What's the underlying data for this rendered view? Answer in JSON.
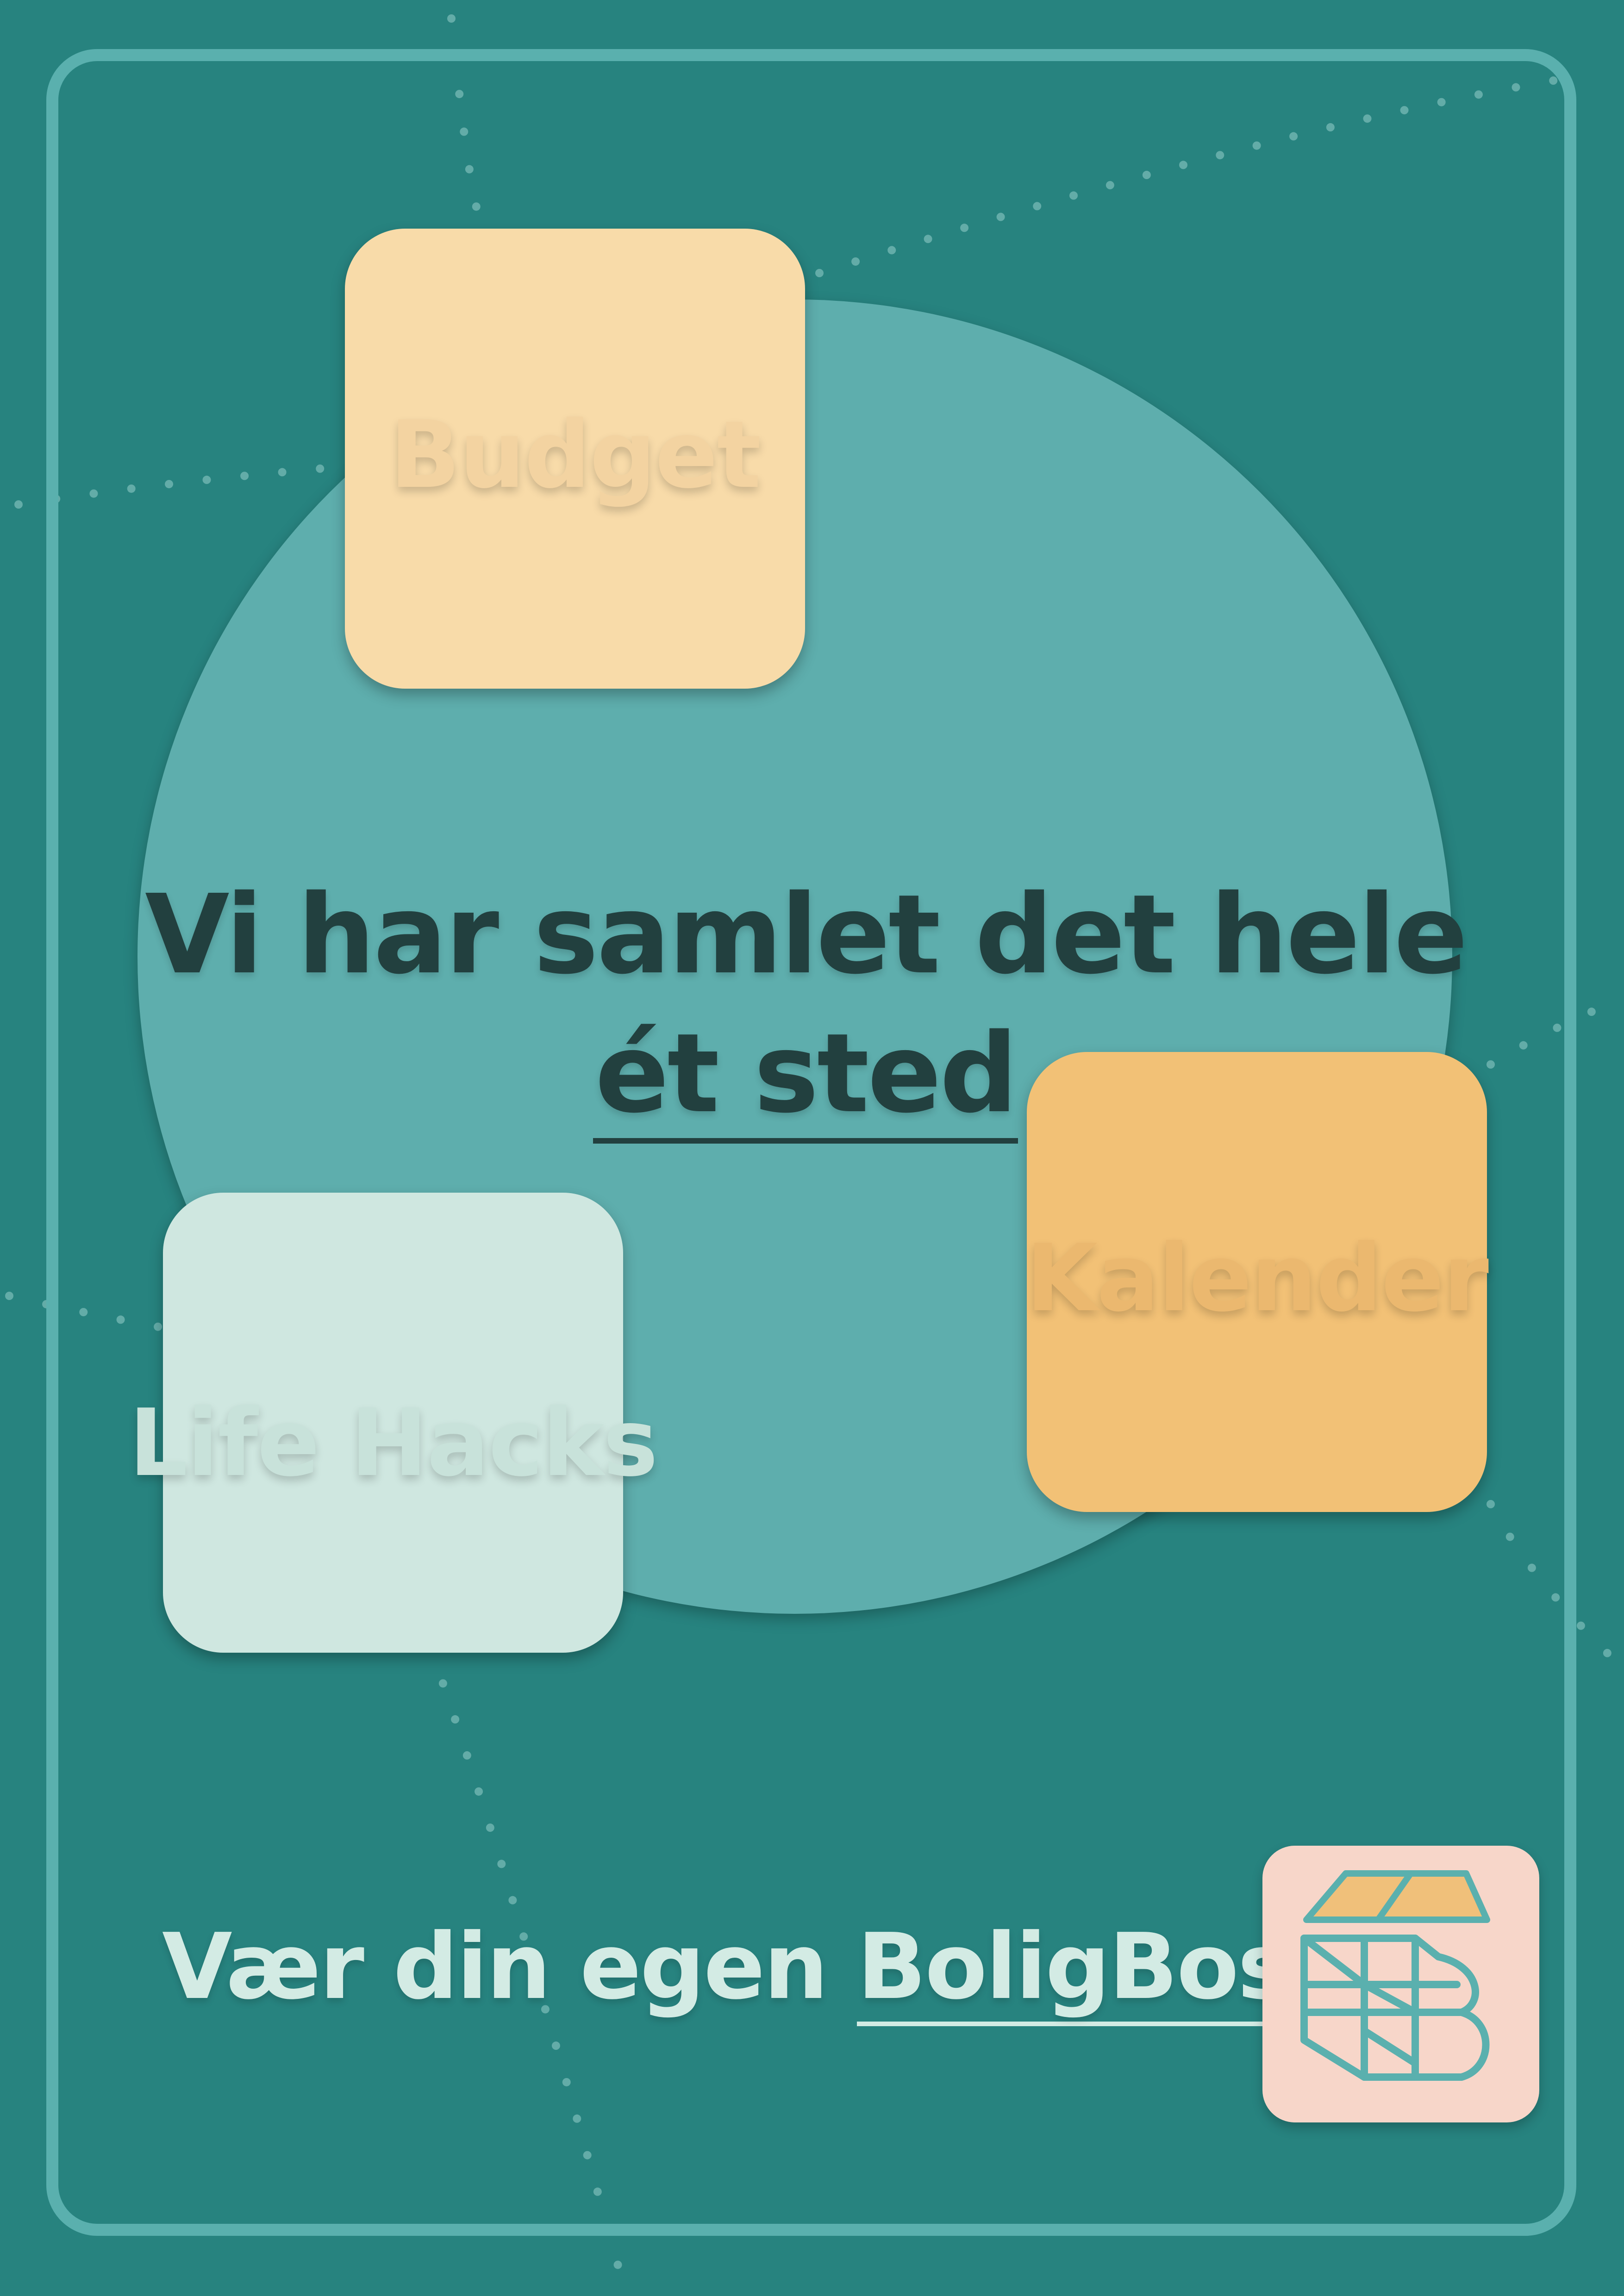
{
  "cards": {
    "budget": "Budget",
    "kalender": "Kalender",
    "life_hacks": "Life Hacks"
  },
  "headline": {
    "line1": "Vi har samlet det hele",
    "line2": "ét sted"
  },
  "tagline": {
    "prefix": "Vær din egen",
    "brand": "BoligBoss"
  },
  "colors": {
    "background": "#27837f",
    "frame": "#5ab0ae",
    "circle": "#5eaead",
    "budget_card": "#f8dba9",
    "kalender_card": "#f2c176",
    "life_hacks_card": "#cfe7e0",
    "headline_text": "#22403f",
    "tagline_text": "#d3ebe4",
    "logo_background": "#f7d6c9"
  },
  "logo": {
    "icon": "house-b-logo-icon"
  }
}
